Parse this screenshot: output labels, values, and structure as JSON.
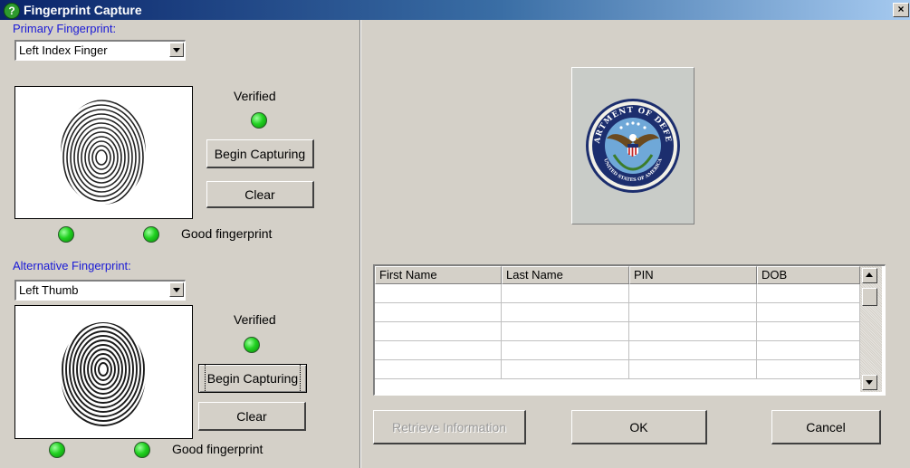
{
  "window": {
    "title": "Fingerprint Capture",
    "close_glyph": "×",
    "help_glyph": "?"
  },
  "primary": {
    "section_label": "Primary Fingerprint:",
    "finger_selected": "Left Index Finger",
    "verified_label": "Verified",
    "begin_button": "Begin Capturing",
    "clear_button": "Clear",
    "quality_label": "Good fingerprint"
  },
  "alternative": {
    "section_label": "Alternative Fingerprint:",
    "finger_selected": "Left Thumb",
    "verified_label": "Verified",
    "begin_button": "Begin Capturing",
    "clear_button": "Clear",
    "quality_label": "Good fingerprint"
  },
  "logo": {
    "seal_top_text": "DEPARTMENT OF DEFENSE",
    "seal_bottom_text": "UNITED STATES OF AMERICA"
  },
  "grid": {
    "columns": [
      "First Name",
      "Last Name",
      "PIN",
      "DOB"
    ],
    "rows": [
      [
        "",
        "",
        "",
        ""
      ],
      [
        "",
        "",
        "",
        ""
      ],
      [
        "",
        "",
        "",
        ""
      ],
      [
        "",
        "",
        "",
        ""
      ],
      [
        "",
        "",
        "",
        ""
      ]
    ]
  },
  "footer": {
    "retrieve_button": "Retrieve Information",
    "ok_button": "OK",
    "cancel_button": "Cancel"
  },
  "colors": {
    "led_status": "#21d121",
    "section_label": "#1a1ad6",
    "titlebar_start": "#0a246a",
    "titlebar_end": "#a6caf0"
  },
  "icons": {
    "help": "help-icon",
    "close": "close-icon",
    "dropdown": "chevron-down-icon",
    "scroll_up": "scroll-up-icon",
    "scroll_down": "scroll-down-icon"
  }
}
